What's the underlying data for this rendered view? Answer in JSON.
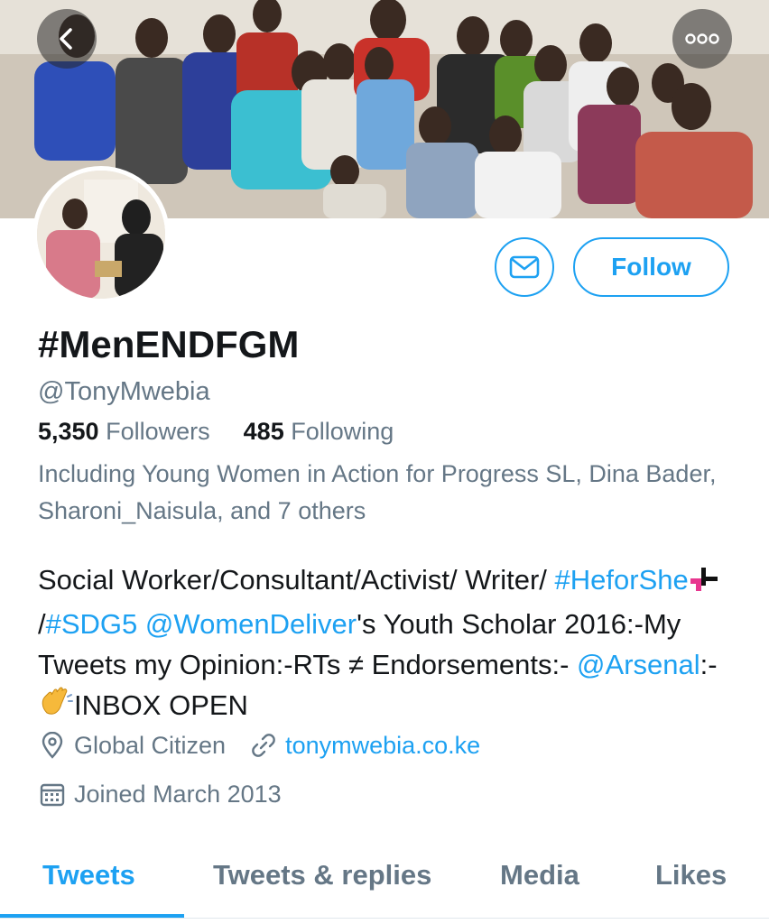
{
  "header": {
    "back_icon": "chevron-left-icon",
    "more_icon": "ellipsis-icon"
  },
  "profile": {
    "display_name": "#MenENDFGM",
    "handle": "@TonyMwebia",
    "followers_count": "5,350",
    "followers_label": "Followers",
    "following_count": "485",
    "following_label": "Following",
    "followed_by": "Including Young Women in Action for Progress SL, Dina Bader, Sharoni_Naisula, and 7 others"
  },
  "actions": {
    "message_icon": "envelope-icon",
    "follow_label": "Follow"
  },
  "bio": {
    "part1": "Social Worker/Consultant/Activist/ Writer/ ",
    "hashtag1": "#HeforShe",
    "part2": "/",
    "hashtag2": "#SDG5",
    "part3": " ",
    "mention1": "@WomenDeliver",
    "part4": "'s Youth Scholar 2016:-My Tweets my Opinion:-RTs ≠ Endorsements:- ",
    "mention2": "@Arsenal",
    "part5": ":-",
    "part6": "INBOX OPEN"
  },
  "meta": {
    "location": "Global Citizen",
    "website": "tonymwebia.co.ke",
    "joined": "Joined March 2013",
    "location_icon": "location-pin-icon",
    "link_icon": "link-icon",
    "calendar_icon": "calendar-icon"
  },
  "tabs": [
    {
      "label": "Tweets",
      "active": true
    },
    {
      "label": "Tweets & replies",
      "active": false
    },
    {
      "label": "Media",
      "active": false
    },
    {
      "label": "Likes",
      "active": false
    }
  ],
  "colors": {
    "accent": "#1da1f2",
    "secondary_text": "#657786",
    "primary_text": "#14171a"
  }
}
